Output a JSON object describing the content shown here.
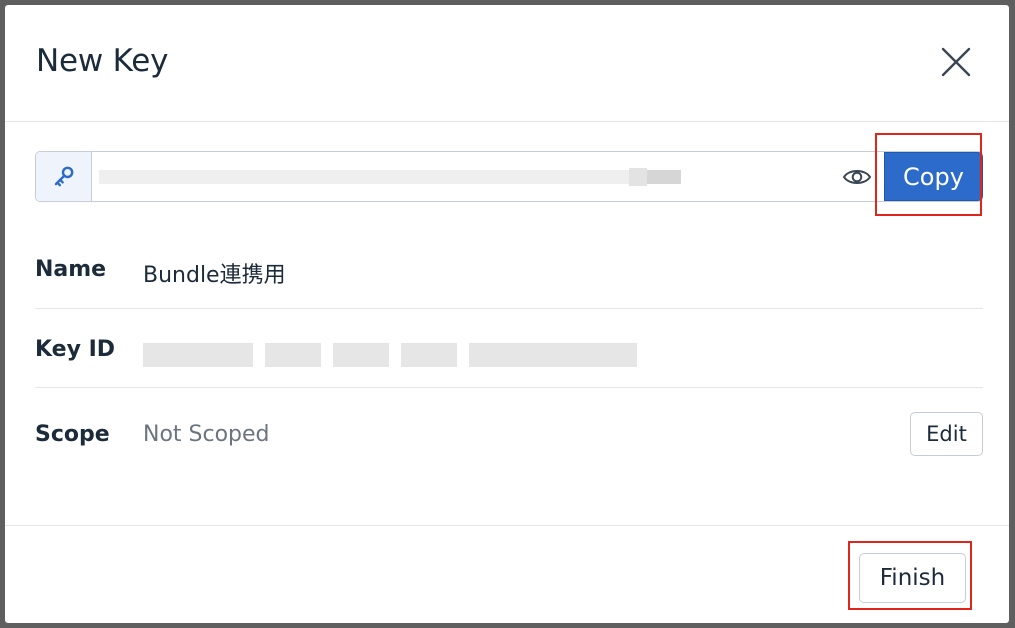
{
  "modal": {
    "title": "New Key",
    "close_icon": "close-icon"
  },
  "key_field": {
    "addon_icon": "key-icon",
    "value": "",
    "toggle_icon": "eye-icon",
    "copy_label": "Copy"
  },
  "details": {
    "name_label": "Name",
    "name_value": "Bundle連携用",
    "key_id_label": "Key ID",
    "key_id_value": "",
    "scope_label": "Scope",
    "scope_value": "Not Scoped",
    "edit_label": "Edit"
  },
  "footer": {
    "finish_label": "Finish"
  },
  "colors": {
    "primary": "#2c6bca",
    "highlight": "#e0251b",
    "addon_bg": "#eef3fc"
  }
}
